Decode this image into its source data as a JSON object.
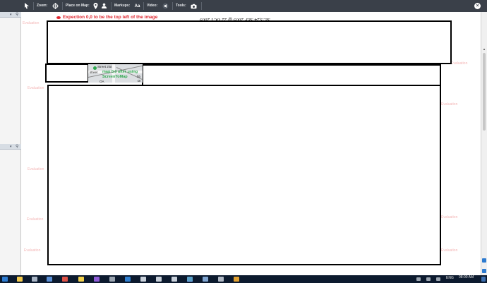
{
  "toolbar": {
    "zoom_label": "Zoom:",
    "place_label": "Place on Map:",
    "markups_label": "Markups:",
    "markups_icon_text": "Aa",
    "video_label": "Video:",
    "tools_label": "Tools:",
    "icons": [
      "cursor-icon",
      "crosshair-icon",
      "pin-icon",
      "camera-person-icon",
      "text-icon",
      "sound-icon",
      "camera-icon",
      "close-icon"
    ]
  },
  "canvas": {
    "note": "Expection 0,0 to be the top left of the image",
    "mirrored_header": "SE:S,24 SEP 2009 @ 22 OCT 2009",
    "watermark": "Evaluation",
    "map_label_1": "Street 2lot",
    "map_label_2": "street",
    "map_label_3": "hb",
    "map_label_4": "DI",
    "map_label_5": "OA",
    "overlay_line_1": "map 0,0 after using ",
    "overlay_line_2": "ScreenToMap"
  },
  "taskbar": {
    "lang": "ENG",
    "time": "08:00 AM"
  },
  "colors": {
    "toolbar_bg": "#3a4049",
    "note_red": "#e0262f",
    "overlay_green": "#2fa84f",
    "taskbar_bg": "#0c1a2e",
    "watermark": "#f4b6b6"
  }
}
